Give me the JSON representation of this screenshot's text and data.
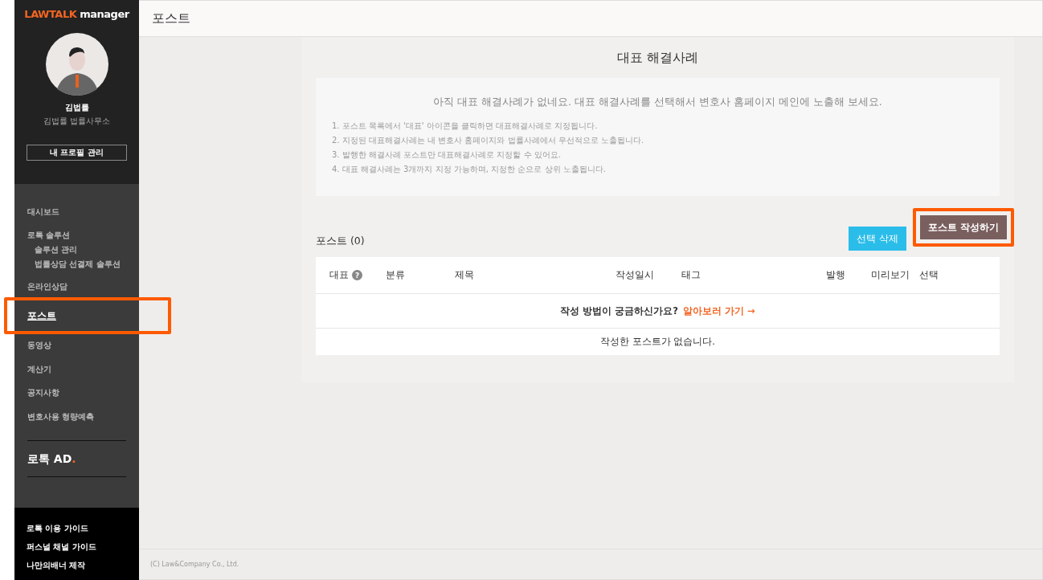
{
  "sidebar": {
    "logo": {
      "brand": "LAWTALK",
      "suffix": "manager"
    },
    "profile": {
      "name": "김법률",
      "office": "김법률 법률사무소",
      "button": "내 프로필 관리"
    },
    "menu": [
      {
        "label": "대시보드",
        "selected": false
      },
      {
        "label": "로톡 솔루션",
        "selected": false,
        "children": [
          {
            "label": "솔루션 관리",
            "selected": false
          },
          {
            "label": "법률상담 선결제 솔루션",
            "selected": false
          }
        ]
      },
      {
        "label": "온라인상담",
        "selected": false
      },
      {
        "label": "포스트",
        "selected": true,
        "highlighted": true
      },
      {
        "label": "동영상",
        "selected": false
      },
      {
        "label": "계산기",
        "selected": false
      },
      {
        "label": "공지사항",
        "selected": false
      },
      {
        "label": "변호사용 형량예측",
        "selected": false
      }
    ],
    "ad": {
      "label": "로톡 AD",
      "dot": "."
    },
    "footer_links": [
      "로톡 이용 가이드",
      "퍼스널 채널 가이드",
      "나만의배너 제작"
    ]
  },
  "header": {
    "title": "포스트"
  },
  "featured": {
    "title": "대표 해결사례",
    "message": "아직 대표 해결사례가 없네요. 대표 해결사례를 선택해서 변호사 홈페이지 메인에 노출해 보세요.",
    "notes": [
      "1. 포스트 목록에서 '대표' 아이콘을 클릭하면 대표해결사례로 지정됩니다.",
      "2. 지정된 대표해결사례는 내 변호사 홈페이지와 법률사례에서 우선적으로 노출됩니다.",
      "3. 발행한 해결사례 포스트만 대표해결사례로 지정할 수 있어요.",
      "4. 대표 해결사례는 3개까지 지정 가능하며, 지정한 순으로 상위 노출됩니다."
    ]
  },
  "posts": {
    "title": "포스트 (0)",
    "buttons": [
      {
        "label": "선택 삭제",
        "kind": "secondary",
        "highlighted": false
      },
      {
        "label": "포스트 작성하기",
        "kind": "primary",
        "highlighted": true
      }
    ],
    "columns": [
      {
        "label": "대표",
        "help": "?"
      },
      {
        "label": "분류"
      },
      {
        "label": "제목"
      },
      {
        "label": "작성일시"
      },
      {
        "label": "태그"
      },
      {
        "label": "발행"
      },
      {
        "label": "미리보기"
      },
      {
        "label": "선택"
      }
    ],
    "guide": {
      "text": "작성 방법이 궁금하신가요?",
      "link": "알아보러 가기 →"
    },
    "empty": "작성한 포스트가 없습니다."
  },
  "footer": "(C) Law&Company Co., Ltd."
}
